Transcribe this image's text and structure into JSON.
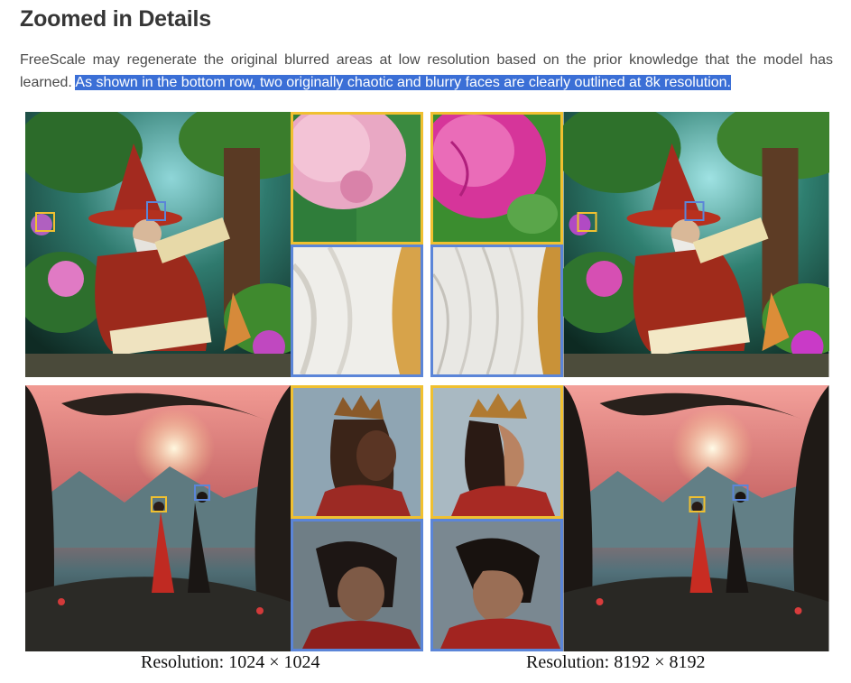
{
  "section": {
    "title": "Zoomed in Details",
    "paragraph_plain": "FreeScale may regenerate the original blurred areas at low resolution based on the prior knowledge that the model has learned. ",
    "paragraph_highlighted": "As shown in the bottom row, two originally chaotic and blurry faces are clearly outlined at 8k resolution."
  },
  "figure": {
    "captions": {
      "left": "Resolution: 1024 × 1024",
      "right": "Resolution: 8192 × 8192"
    },
    "rows": [
      {
        "scene": "wizard",
        "crops": [
          "flower-detail",
          "beard-detail"
        ]
      },
      {
        "scene": "couple",
        "crops": [
          "woman-face-detail",
          "man-face-detail"
        ]
      }
    ],
    "colors": {
      "highlight": "#3b6fd6",
      "crop_border_top": "#f0c030",
      "crop_border_bottom": "#5b85d8"
    }
  }
}
